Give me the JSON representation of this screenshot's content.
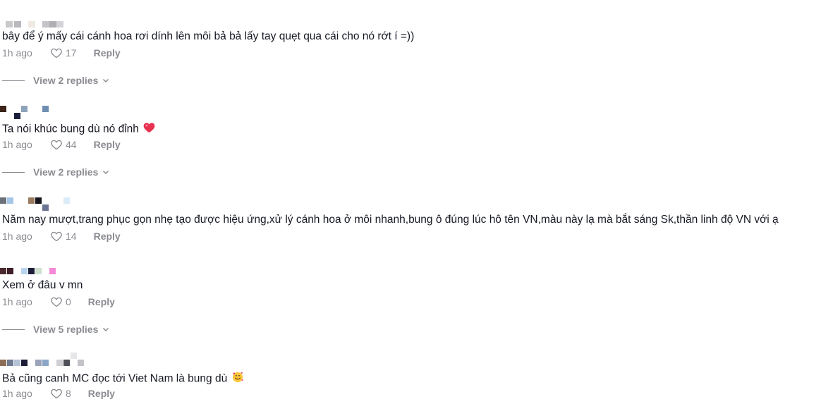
{
  "comments": [
    {
      "text": "bây để ý mấy cái cánh hoa rơi dính lên môi bả bả lấy tay quẹt qua cái cho nó rớt í =))",
      "time": "1h ago",
      "likes": "17",
      "reply_label": "Reply",
      "view_replies": "View 2 replies"
    },
    {
      "text": "Ta nói khúc bung dù nó đỉnh",
      "emoji_icon": "heart-emoji",
      "time": "1h ago",
      "likes": "44",
      "reply_label": "Reply",
      "view_replies": "View 2 replies"
    },
    {
      "text": "Năm nay mượt,trang phục gọn nhẹ tạo được hiệu ứng,xử lý cánh hoa ở môi nhanh,bung ô đúng lúc hô tên VN,màu này lạ mà bắt sáng Sk,thần linh độ VN với ạ",
      "time": "1h ago",
      "likes": "14",
      "reply_label": "Reply"
    },
    {
      "text": "Xem ở đâu v mn",
      "time": "1h ago",
      "likes": "0",
      "reply_label": "Reply",
      "view_replies": "View 5 replies"
    },
    {
      "text": "Bả cũng canh MC đọc tới Viet Nam là bung dù",
      "emoji_icon": "smiling-face-with-hearts-emoji",
      "time": "1h ago",
      "likes": "8",
      "reply_label": "Reply"
    }
  ],
  "colors": {
    "text": "#161823",
    "muted": "#8a8b91",
    "heart_emoji": "#e8304f"
  },
  "icons": {
    "like": "heart-outline-icon",
    "expand": "chevron-down-icon"
  }
}
